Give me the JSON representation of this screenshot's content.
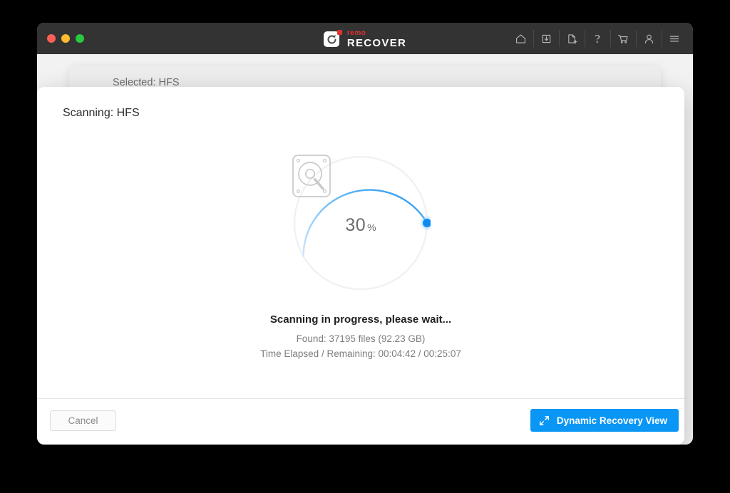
{
  "window": {
    "traffic_lights": [
      "close",
      "minimize",
      "zoom"
    ],
    "brand": {
      "name_top": "remo",
      "name_bottom": "RECOVER",
      "mark_icon": "recovery-refresh-icon",
      "accent_red": "#e03131"
    },
    "toolbar": [
      {
        "icon": "home-icon",
        "name": "home"
      },
      {
        "icon": "save-session-icon",
        "name": "save-session"
      },
      {
        "icon": "new-file-icon",
        "name": "new-file"
      },
      {
        "icon": "help-icon",
        "name": "help",
        "glyph": "?"
      },
      {
        "icon": "cart-icon",
        "name": "cart"
      },
      {
        "icon": "user-icon",
        "name": "account"
      },
      {
        "icon": "menu-icon",
        "name": "menu"
      }
    ],
    "titlebar_bg": "#333333"
  },
  "background_panel": {
    "selected_label": "Selected: HFS"
  },
  "modal": {
    "title": "Scanning: HFS",
    "progress": {
      "percent": 30,
      "percent_value": "30",
      "percent_symbol": "%",
      "icon": "hard-drive-search-icon",
      "arc_color": "#2196f3",
      "track_color": "#f0f0f2",
      "knob_color": "#0d8bf2"
    },
    "status": {
      "headline": "Scanning in progress, please wait...",
      "found": "Found: 37195 files (92.23 GB)",
      "time": "Time Elapsed / Remaining: 00:04:42 / 00:25:07"
    },
    "footer": {
      "cancel_label": "Cancel",
      "primary_label": "Dynamic Recovery View",
      "primary_icon": "expand-diagonal-icon",
      "primary_color": "#0a96f5"
    }
  }
}
